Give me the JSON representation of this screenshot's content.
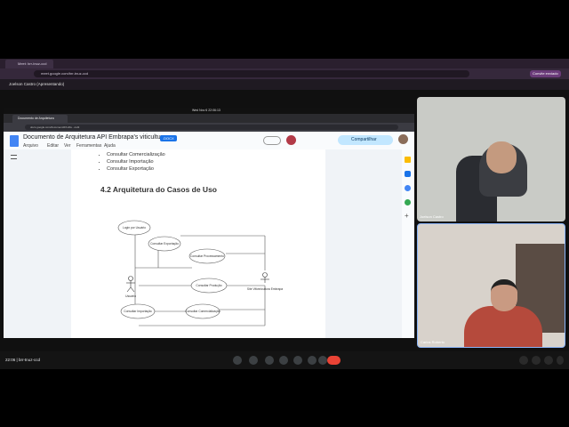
{
  "outer_browser": {
    "tab": "Meet: brr-tnuz-ccd",
    "url": "meet.google.com/brr-tnuz-ccd",
    "profile_badge": "Convite enviado",
    "banner": "Joelson Castro (Apresentando)"
  },
  "inner_browser": {
    "tab": "Documento de Arquitetura",
    "url": "docs.google.com/document/d/1vRe.../edit",
    "clock": "Wed Nov 6  22:06:13"
  },
  "docs": {
    "title": "Documento de Arquitetura API Embrapa's viticulture",
    "badge": ".DOCX",
    "menu": [
      "Arquivo",
      "Editar",
      "Ver",
      "Ferramentas",
      "Ajuda"
    ],
    "share_label": "Compartilhar",
    "bullets": [
      "Consultar Comercialização",
      "Consultar Importação",
      "Consultar Exportação"
    ],
    "heading": "4.2 Arquitetura do Casos de Uso",
    "diagram": {
      "actor": "Usuário",
      "system": "Site Vitivinicultura Embrapa",
      "use_cases": [
        "Login por Usuário",
        "Consultar Exportação",
        "Consultar Processamento",
        "Consultar Produção",
        "Consultar Importação",
        "Consultar Comercialização"
      ]
    }
  },
  "participants": [
    {
      "name": "Joelson Castro"
    },
    {
      "name": "Carlos Roberto"
    }
  ],
  "bottom": {
    "time": "22:06",
    "meeting_code": "brr-tnuz-ccd"
  }
}
